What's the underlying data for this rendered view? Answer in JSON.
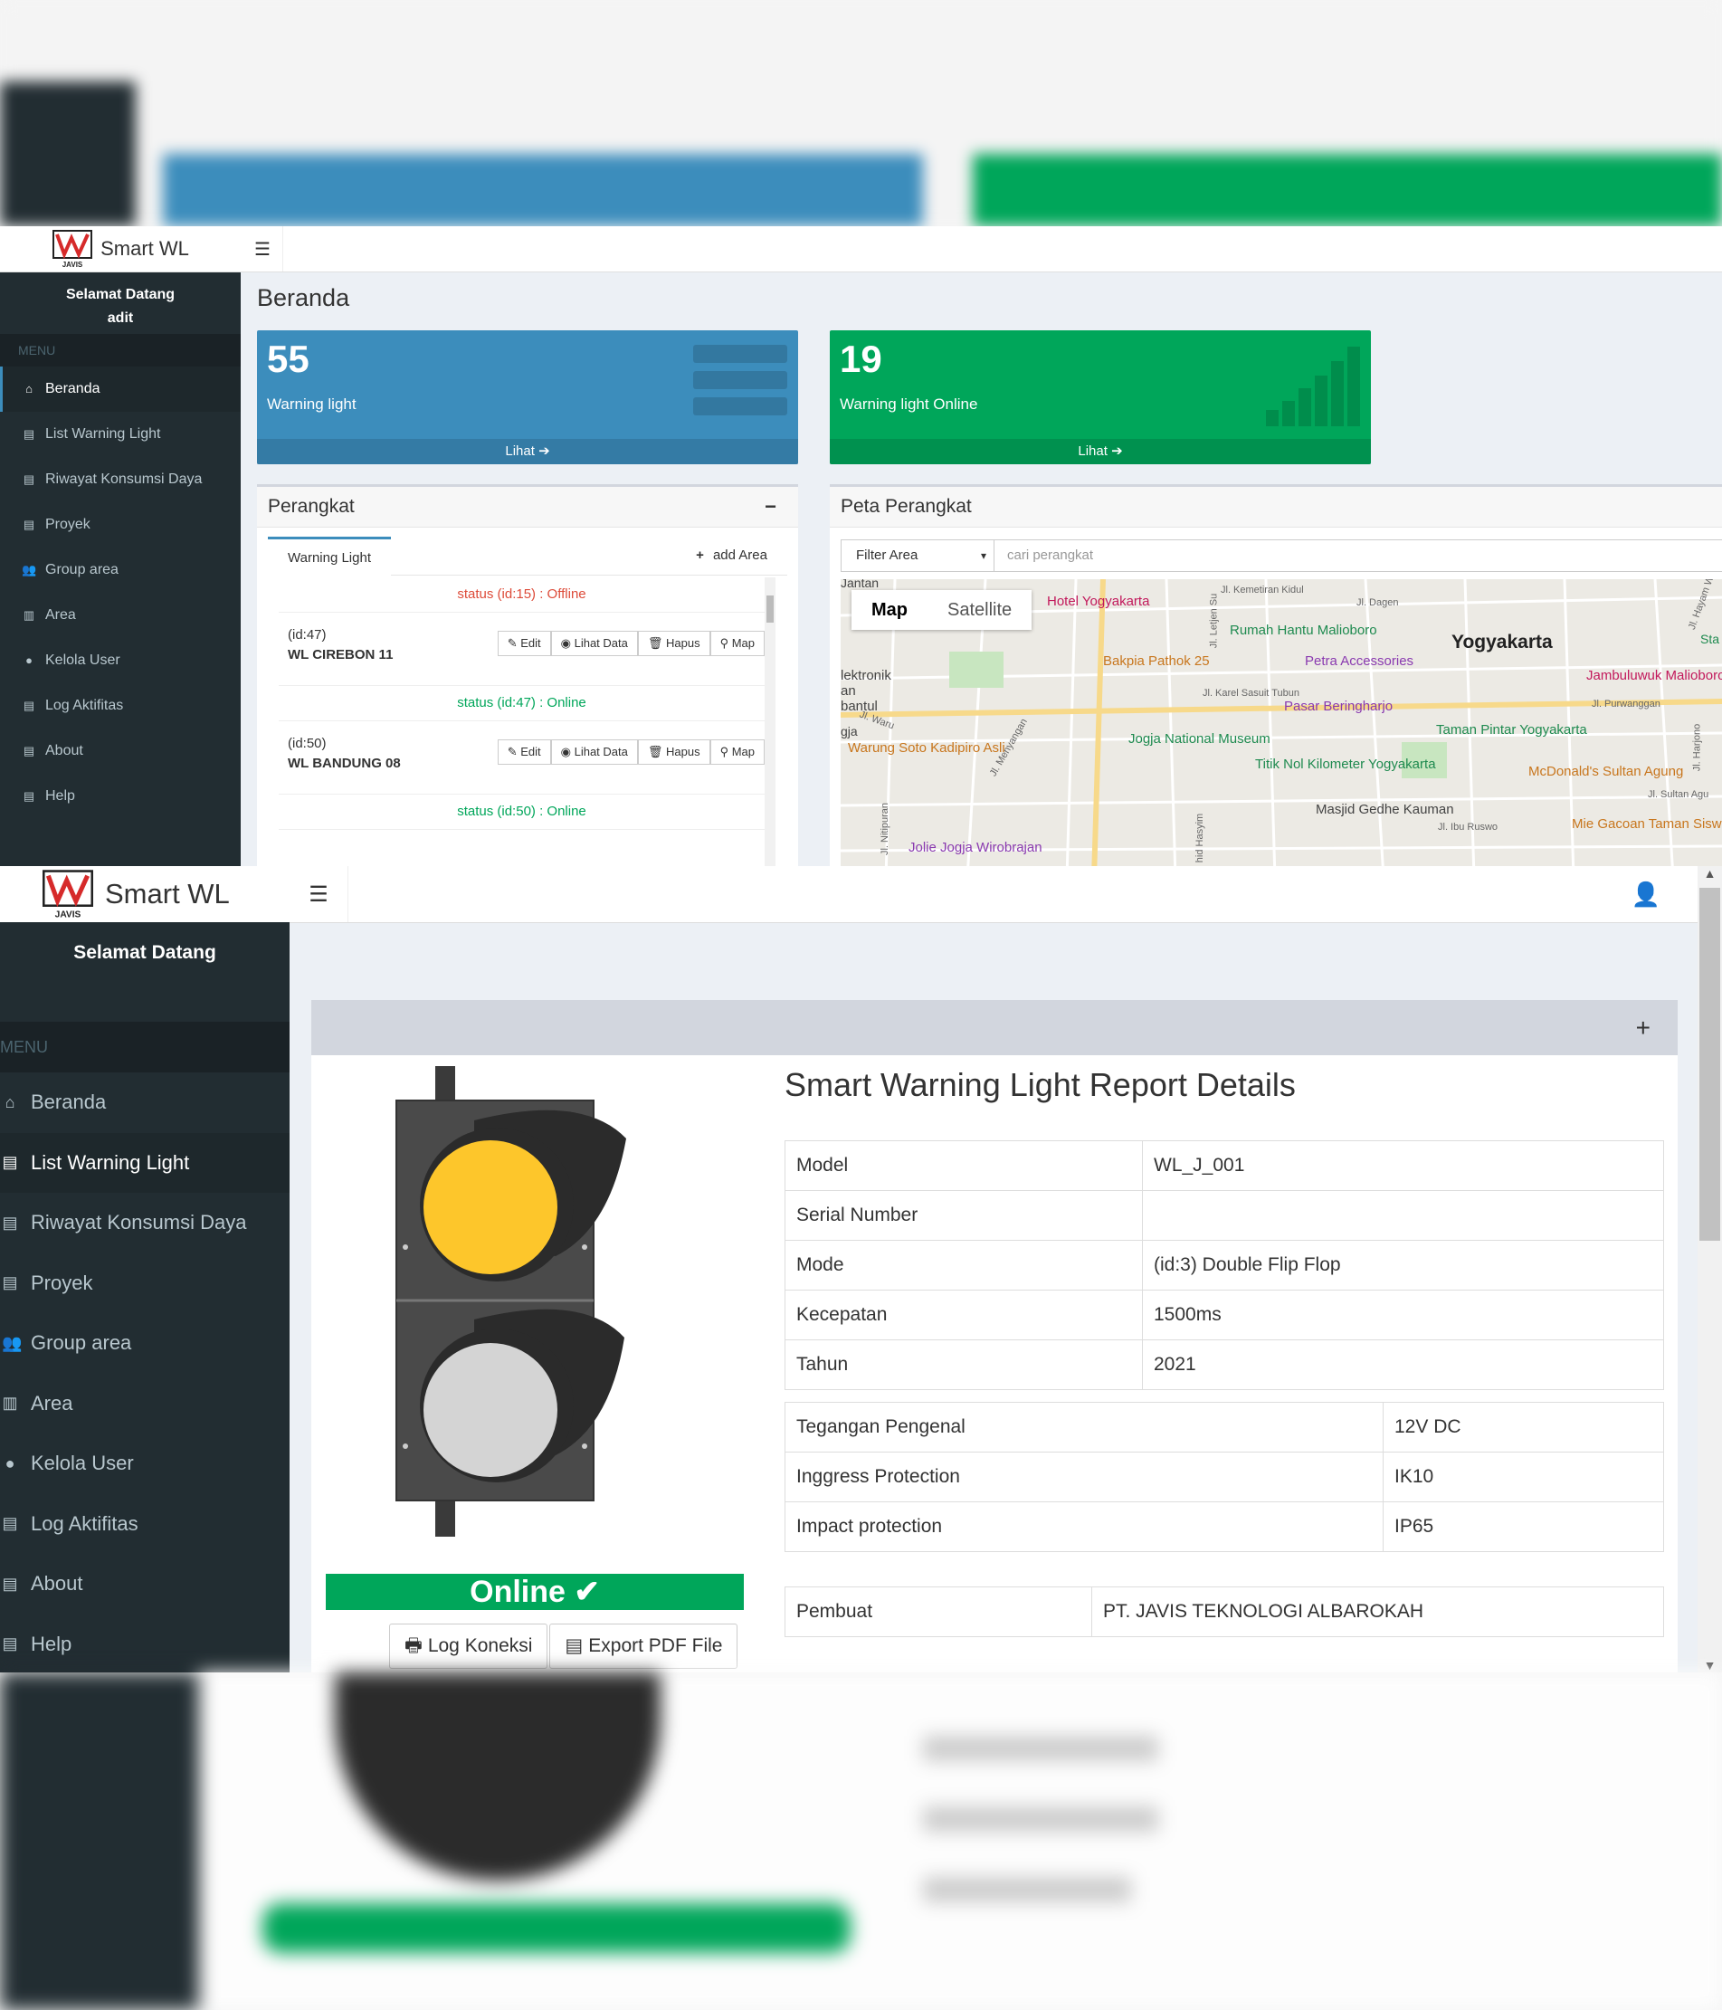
{
  "app": {
    "name": "Smart WL",
    "logo_text": "JAVIS"
  },
  "dashboard": {
    "sidebar": {
      "welcome": "Selamat Datang",
      "username": "adit",
      "menu_header": "MENU",
      "items": [
        {
          "label": "Beranda",
          "icon": "home-icon"
        },
        {
          "label": "List Warning Light",
          "icon": "file-icon"
        },
        {
          "label": "Riwayat Konsumsi Daya",
          "icon": "file-icon"
        },
        {
          "label": "Proyek",
          "icon": "file-icon"
        },
        {
          "label": "Group area",
          "icon": "users-icon"
        },
        {
          "label": "Area",
          "icon": "map-icon"
        },
        {
          "label": "Kelola User",
          "icon": "user-icon"
        },
        {
          "label": "Log Aktifitas",
          "icon": "file-icon"
        },
        {
          "label": "About",
          "icon": "file-icon"
        },
        {
          "label": "Help",
          "icon": "file-icon"
        }
      ]
    },
    "page_title": "Beranda",
    "cards": [
      {
        "value": "55",
        "label": "Warning light",
        "link": "Lihat",
        "color": "#3c8dbc"
      },
      {
        "value": "19",
        "label": "Warning light Online",
        "link": "Lihat",
        "color": "#00a65a"
      }
    ],
    "perangkat": {
      "title": "Perangkat",
      "collapse": "−",
      "tab": "Warning Light",
      "add_area": "add Area",
      "entries": [
        {
          "status": "status (id:15) : Offline",
          "online": false
        },
        {
          "id": "(id:47)",
          "name": "WL CIREBON 11",
          "status": "status (id:47) : Online",
          "online": true
        },
        {
          "id": "(id:50)",
          "name": "WL BANDUNG 08",
          "status": "status (id:50) : Online",
          "online": true
        }
      ],
      "buttons": [
        "Edit",
        "Lihat Data",
        "Hapus",
        "Map"
      ]
    },
    "peta": {
      "title": "Peta Perangkat",
      "filter": "Filter Area",
      "search_placeholder": "cari perangkat",
      "map_tabs": [
        "Map",
        "Satellite"
      ],
      "places": [
        "Yogyakarta",
        "Rumah Hantu Malioboro",
        "Petra Accessories",
        "Bakpia Pathok 25",
        "Pasar Beringharjo",
        "Jogja National Museum",
        "Taman Pintar Yogyakarta",
        "Titik Nol Kilometer Yogyakarta",
        "McDonald's Sultan Agung",
        "Masjid Gedhe Kauman",
        "Mie Gacoan Taman Sisw",
        "Jolie Jogja Wirobrajan",
        "Warung Soto Kadipiro Asli",
        "Jambuluwuk Malioboro",
        "Hotel Yogyakarta",
        "lektronik an bantul",
        "Jl. Dagen",
        "Jl. Kemetiran Kidul",
        "Jl. Karel Sasuit Tubun",
        "Jl. Purwanggan",
        "Jl. Sultan Agu",
        "Jl. Ibu Ruswo",
        "Jl. Letjen Su",
        "Jl. Waru",
        "Jl. Menyangan",
        "Jl. Nitipuran",
        "hid Hasyim",
        "Jl. Hayam W",
        "Jl. Harjono",
        "Jantan",
        "Sta",
        "gja"
      ]
    }
  },
  "detail": {
    "sidebar": {
      "welcome": "Selamat Datang",
      "menu_header": "MENU",
      "items": [
        {
          "label": "Beranda",
          "icon": "home-icon"
        },
        {
          "label": "List Warning Light",
          "icon": "file-icon",
          "active": true
        },
        {
          "label": "Riwayat Konsumsi Daya",
          "icon": "file-icon"
        },
        {
          "label": "Proyek",
          "icon": "file-icon"
        },
        {
          "label": "Group area",
          "icon": "users-icon"
        },
        {
          "label": "Area",
          "icon": "map-icon"
        },
        {
          "label": "Kelola User",
          "icon": "user-icon"
        },
        {
          "label": "Log Aktifitas",
          "icon": "file-icon"
        },
        {
          "label": "About",
          "icon": "file-icon"
        },
        {
          "label": "Help",
          "icon": "file-icon"
        }
      ]
    },
    "expand": "+",
    "title": "Smart Warning Light Report Details",
    "spec1": [
      {
        "k": "Model",
        "v": "WL_J_001"
      },
      {
        "k": "Serial Number",
        "v": ""
      },
      {
        "k": "Mode",
        "v": "(id:3) Double Flip Flop"
      },
      {
        "k": "Kecepatan",
        "v": "1500ms"
      },
      {
        "k": "Tahun",
        "v": "2021"
      }
    ],
    "spec2": [
      {
        "k": "Tegangan Pengenal",
        "v": "12V DC"
      },
      {
        "k": "Inggress Protection",
        "v": "IK10"
      },
      {
        "k": "Impact protection",
        "v": "IP65"
      }
    ],
    "spec3": [
      {
        "k": "Pembuat",
        "v": "PT. JAVIS TEKNOLOGI ALBAROKAH"
      }
    ],
    "status": "Online",
    "log_button": "Log Koneksi",
    "export_button": "Export PDF File",
    "light_colors": {
      "top": "#fdc62b",
      "bottom": "#d4d4d4"
    }
  }
}
